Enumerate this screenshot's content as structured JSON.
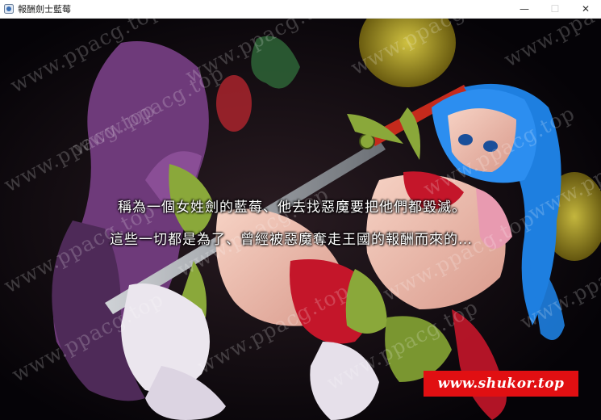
{
  "window": {
    "title": "報酬劍士藍莓",
    "controls": {
      "minimize": "—",
      "maximize": "☐",
      "close": "✕"
    }
  },
  "dialogue": {
    "line1": "稱為一個女姓劍的藍莓、他去找惡魔要把他們都毀滅。",
    "line2": "這些一切都是為了、曾經被惡魔奪走王國的報酬而來的…"
  },
  "watermark": {
    "text": "www.ppacg.top"
  },
  "banner": {
    "text": "www.shukor.top",
    "color": "#e10f12"
  },
  "colors": {
    "background": "#060408",
    "heroine_hair": "#1e7fe0",
    "armor": "#8aa83a",
    "outfit_red": "#c4162a",
    "purple_creature": "#6e3a7a"
  },
  "icons": [
    "app-icon",
    "minimize-icon",
    "maximize-icon",
    "close-icon"
  ]
}
